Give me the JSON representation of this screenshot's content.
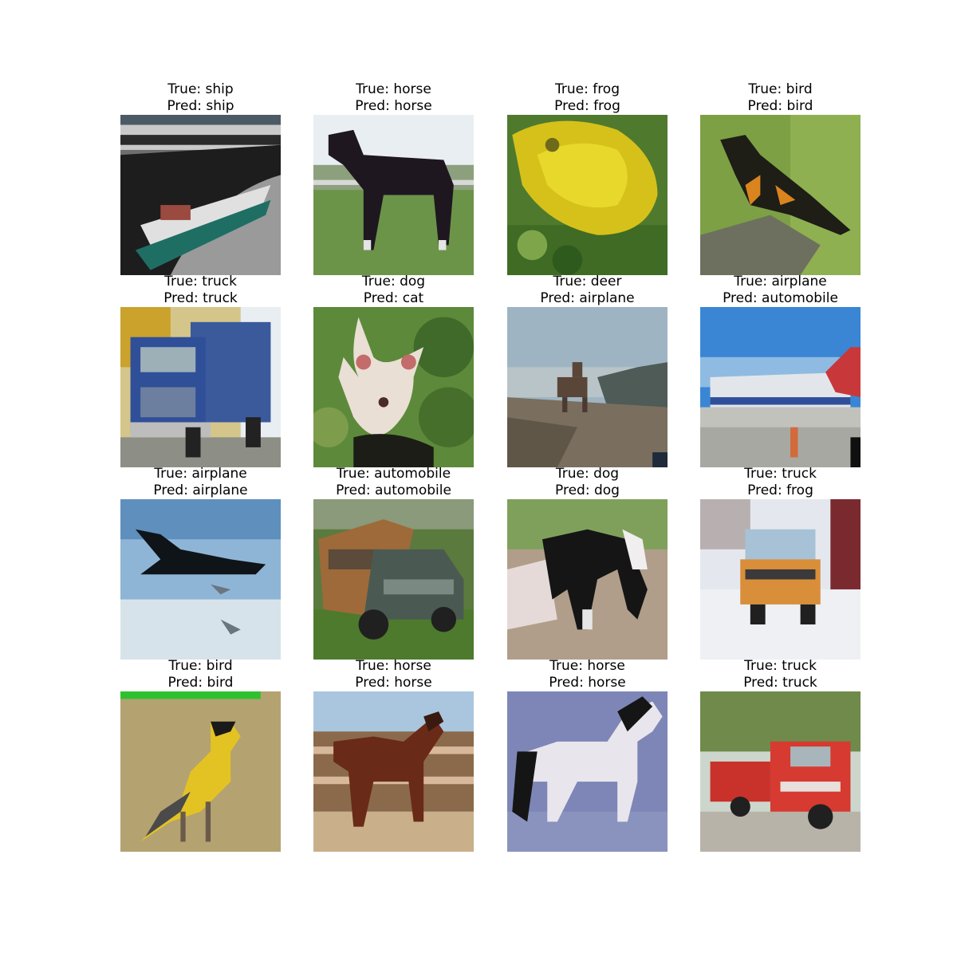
{
  "figure": {
    "panels": [
      {
        "true_text": "True: ship",
        "pred_text": "Pred: ship",
        "subject": "boat-on-water"
      },
      {
        "true_text": "True: horse",
        "pred_text": "Pred: horse",
        "subject": "dark-horse-on-grass"
      },
      {
        "true_text": "True: frog",
        "pred_text": "Pred: frog",
        "subject": "yellow-frog"
      },
      {
        "true_text": "True: bird",
        "pred_text": "Pred: bird",
        "subject": "black-orange-bird-on-branch"
      },
      {
        "true_text": "True: truck",
        "pred_text": "Pred: truck",
        "subject": "blue-truck"
      },
      {
        "true_text": "True: dog",
        "pred_text": "Pred: cat",
        "subject": "white-dog-in-foliage"
      },
      {
        "true_text": "True: deer",
        "pred_text": "Pred: airplane",
        "subject": "deer-in-landscape"
      },
      {
        "true_text": "True: airplane",
        "pred_text": "Pred: automobile",
        "subject": "airliner-on-tarmac"
      },
      {
        "true_text": "True: airplane",
        "pred_text": "Pred: airplane",
        "subject": "black-jet-in-sky"
      },
      {
        "true_text": "True: automobile",
        "pred_text": "Pred: automobile",
        "subject": "woody-station-wagon"
      },
      {
        "true_text": "True: dog",
        "pred_text": "Pred: dog",
        "subject": "black-white-dog"
      },
      {
        "true_text": "True: truck",
        "pred_text": "Pred: frog",
        "subject": "orange-truck-in-snow"
      },
      {
        "true_text": "True: bird",
        "pred_text": "Pred: bird",
        "subject": "yellow-bird-on-branch"
      },
      {
        "true_text": "True: horse",
        "pred_text": "Pred: horse",
        "subject": "brown-horse-by-fence"
      },
      {
        "true_text": "True: horse",
        "pred_text": "Pred: horse",
        "subject": "white-horse"
      },
      {
        "true_text": "True: truck",
        "pred_text": "Pred: truck",
        "subject": "red-fire-truck"
      }
    ]
  }
}
